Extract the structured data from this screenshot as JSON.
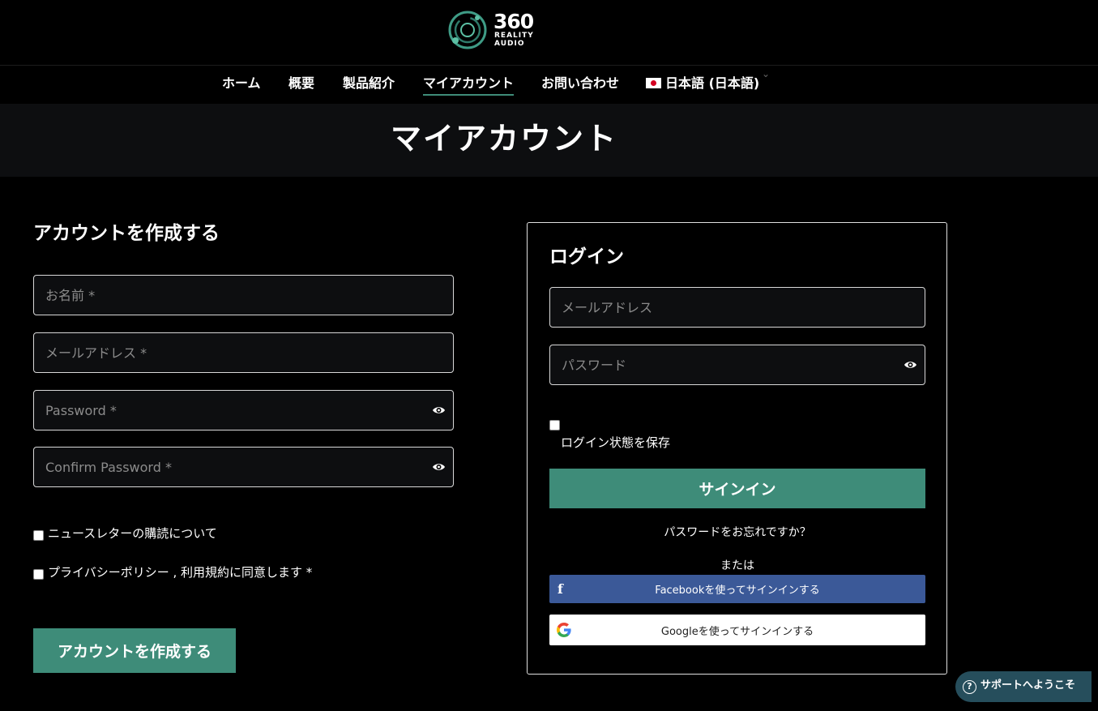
{
  "logo": {
    "number": "360",
    "line1": "REALITY",
    "line2": "AUDIO"
  },
  "nav": {
    "items": [
      "ホーム",
      "概要",
      "製品紹介",
      "マイアカウント",
      "お問い合わせ"
    ],
    "language": "日本語 (日本語)",
    "language_chevron": "⌄"
  },
  "page_title": "マイアカウント",
  "register": {
    "heading": "アカウントを作成する",
    "name_placeholder": "お名前 *",
    "email_placeholder": "メールアドレス *",
    "password_placeholder": "Password *",
    "confirm_placeholder": "Confirm Password *",
    "newsletter_label": "ニュースレターの購読について",
    "privacy_label": "プライバシーポリシー , 利用規約に同意します *",
    "submit_label": "アカウントを作成する"
  },
  "login": {
    "heading": "ログイン",
    "email_placeholder": "メールアドレス",
    "password_placeholder": "パスワード",
    "remember_label": "ログイン状態を保存",
    "signin_label": "サインイン",
    "forgot_label": "パスワードをお忘れですか？",
    "or_label": "または",
    "facebook_label": "Facebookを使ってサインインする",
    "facebook_icon": "f",
    "google_label": "Googleを使ってサインインする"
  },
  "support": {
    "label": "サポートへようこそ",
    "icon": "?"
  },
  "colors": {
    "accent": "#3e8c79",
    "facebook": "#3b5998",
    "support": "#264e5c"
  }
}
